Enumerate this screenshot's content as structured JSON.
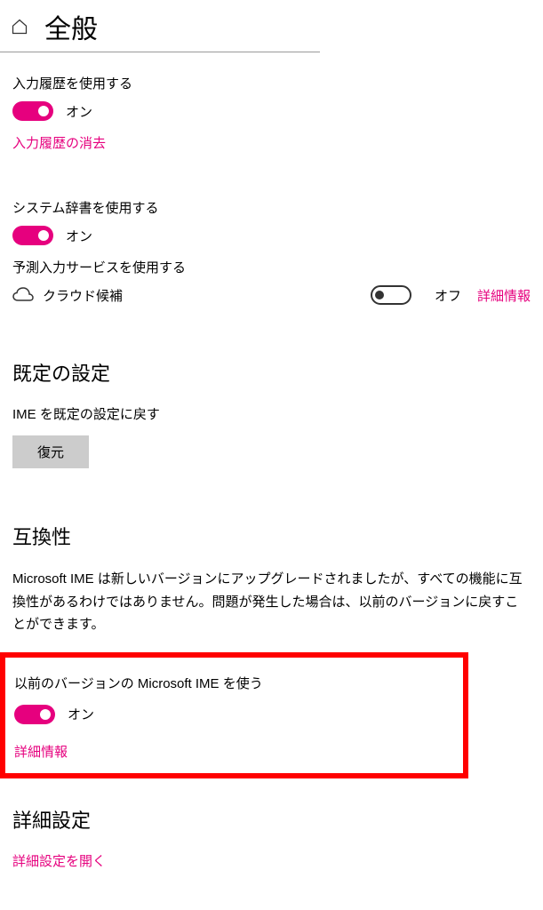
{
  "header": {
    "title": "全般"
  },
  "inputHistory": {
    "label": "入力履歴を使用する",
    "state": "オン",
    "clearLink": "入力履歴の消去"
  },
  "systemDict": {
    "label": "システム辞書を使用する",
    "state": "オン"
  },
  "predictive": {
    "label": "予測入力サービスを使用する",
    "cloudLabel": "クラウド候補",
    "cloudState": "オフ",
    "detailLink": "詳細情報"
  },
  "defaults": {
    "heading": "既定の設定",
    "subtext": "IME を既定の設定に戻す",
    "buttonLabel": "復元"
  },
  "compat": {
    "heading": "互換性",
    "description": "Microsoft IME は新しいバージョンにアップグレードされましたが、すべての機能に互換性があるわけではありません。問題が発生した場合は、以前のバージョンに戻すことができます。",
    "toggleLabel": "以前のバージョンの Microsoft IME を使う",
    "toggleState": "オン",
    "detailLink": "詳細情報"
  },
  "advanced": {
    "heading": "詳細設定",
    "openLink": "詳細設定を開く"
  }
}
